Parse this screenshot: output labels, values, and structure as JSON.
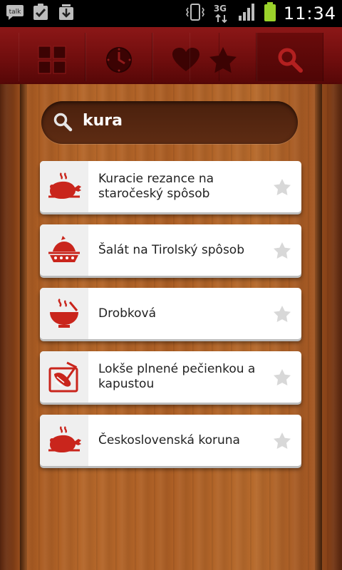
{
  "status_bar": {
    "time": "11:34",
    "left_icons": [
      "talk-icon",
      "checklist-icon",
      "download-icon"
    ],
    "right_icons": [
      "vibrate-icon",
      "3g-icon",
      "signal-icon",
      "battery-icon"
    ],
    "talk_label": "talk",
    "network_label": "3G"
  },
  "tabs": [
    {
      "name": "categories",
      "icon": "grid-icon",
      "active": false
    },
    {
      "name": "recent",
      "icon": "clock-icon",
      "active": false
    },
    {
      "name": "favorites",
      "icon": "heart-icon",
      "active": false
    },
    {
      "name": "starred",
      "icon": "star-icon",
      "active": false
    },
    {
      "name": "search",
      "icon": "search-icon",
      "active": true
    }
  ],
  "search": {
    "value": "kura"
  },
  "results": [
    {
      "title": "Kuracie rezance na staročeský spôsob",
      "icon": "chicken-icon"
    },
    {
      "title": "Šalát na Tirolský spôsob",
      "icon": "pie-icon"
    },
    {
      "title": "Drobková",
      "icon": "soup-bowl-icon"
    },
    {
      "title": "Lokše plnené pečienkou a kapustou",
      "icon": "cutting-board-icon"
    },
    {
      "title": "Československá koruna",
      "icon": "chicken-icon"
    }
  ],
  "colors": {
    "accent_red": "#c9251c",
    "tabbar_red": "#7a1010",
    "wood": "#a85a22",
    "star_grey": "#d8d8d8"
  }
}
